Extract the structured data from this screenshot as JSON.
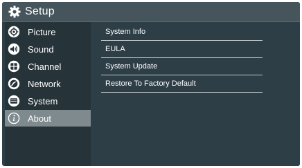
{
  "header": {
    "title": "Setup",
    "icon": "gear-icon"
  },
  "sidebar": {
    "items": [
      {
        "label": "Picture",
        "icon": "picture-icon"
      },
      {
        "label": "Sound",
        "icon": "speaker-icon"
      },
      {
        "label": "Channel",
        "icon": "channel-icon"
      },
      {
        "label": "Network",
        "icon": "network-icon"
      },
      {
        "label": "System",
        "icon": "system-icon"
      },
      {
        "label": "About",
        "icon": "info-icon",
        "selected": true
      }
    ]
  },
  "main": {
    "items": [
      {
        "label": "System Info"
      },
      {
        "label": "EULA"
      },
      {
        "label": "System Update"
      },
      {
        "label": "Restore To Factory Default"
      }
    ]
  },
  "colors": {
    "background": "#2d3e47",
    "titlebar": "#46555b",
    "sidebar": "#263339",
    "selected": "#7f8a8e",
    "divider": "#c3c9cb"
  }
}
